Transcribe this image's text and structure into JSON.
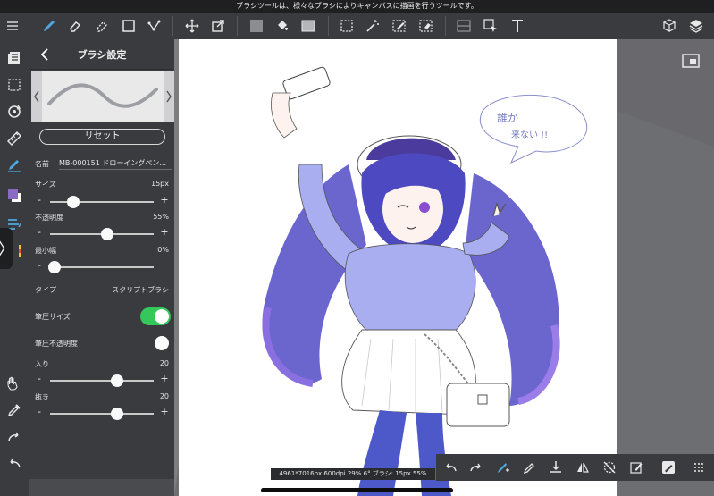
{
  "status": {
    "message": "ブラシツールは、様々なブラシによりキャンバスに描画を行うツールです。"
  },
  "toolbar": {
    "left_icons": [
      "menu-icon",
      "brush-tool-icon",
      "eraser-icon",
      "blur-eraser-icon",
      "rectangle-icon",
      "polyline-icon",
      "move-icon",
      "transform-icon"
    ],
    "middle_icons": [
      "color-fill-icon",
      "bucket-icon",
      "gradient-icon",
      "marquee-icon",
      "magic-wand-icon",
      "select-pen-icon",
      "select-eraser-icon",
      "grid-icon",
      "cursor-select-icon",
      "text-icon"
    ],
    "right_icons": [
      "materials-icon",
      "layers-icon",
      "fullscreen-icon"
    ]
  },
  "panel": {
    "title": "ブラシ設定",
    "reset_label": "リセット",
    "name_label": "名前",
    "name_value": "MB-000151 ドローイングペン...",
    "size": {
      "label": "サイズ",
      "value": "15px",
      "level": 0.22
    },
    "opacity": {
      "label": "不透明度",
      "value": "55%",
      "level": 0.55
    },
    "min_width": {
      "label": "最小幅",
      "value": "0%",
      "level": 0.04
    },
    "type": {
      "label": "タイプ",
      "value": "スクリプトブラシ"
    },
    "pressure_size": {
      "label": "筆圧サイズ",
      "on": true
    },
    "pressure_opacity": {
      "label": "筆圧不透明度",
      "on": false
    },
    "entry": {
      "label": "入り",
      "value": "20",
      "level": 0.65
    },
    "exit": {
      "label": "抜き",
      "value": "20",
      "level": 0.65
    }
  },
  "rail": {
    "icons": [
      "layers-list-icon",
      "selection-icon",
      "rotate-icon",
      "ruler-icon",
      "fill-brush-icon",
      "color-swatch-icon",
      "brush-list-icon",
      "hand-icon",
      "eyedropper-icon",
      "redo-icon",
      "undo-icon"
    ],
    "toggle_label": "〉"
  },
  "bottombar": {
    "icons": [
      "undo-icon",
      "redo-icon",
      "brush-settings-icon",
      "pen-icon",
      "import-icon",
      "flip-icon",
      "rotate-reset-icon",
      "edit-icon",
      "snapshot-icon",
      "grid-dots-icon"
    ]
  },
  "info": {
    "text": "4961*7016px 600dpi 29% 6° ブラシ: 15px 55%"
  },
  "colors": {
    "accent": "#4fa8e0",
    "toggle_on": "#34c759",
    "swatch_front": "#8a6bc4",
    "swatch_back": "#ffffff"
  }
}
